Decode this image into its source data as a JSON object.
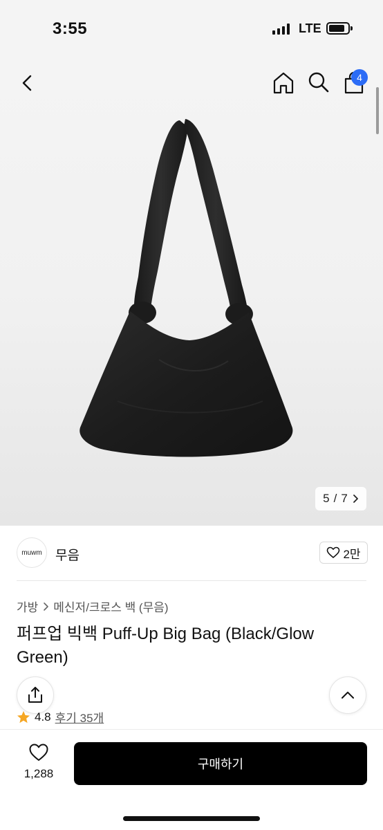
{
  "status_bar": {
    "time": "3:55",
    "network": "LTE"
  },
  "header": {
    "cart_count": "4"
  },
  "gallery": {
    "current": "5",
    "separator": "/",
    "total": "7"
  },
  "brand": {
    "logo_text": "muwm",
    "name": "무음",
    "likes": "2만"
  },
  "product": {
    "breadcrumb": [
      "가방",
      "메신저/크로스 백 (무음)"
    ],
    "title": "퍼프업 빅백 Puff-Up Big Bag (Black/Glow Green)",
    "rating": "4.8",
    "reviews": "후기 35개"
  },
  "bottom_bar": {
    "wish_count": "1,288",
    "buy_label": "구매하기"
  },
  "colors": {
    "badge": "#2c6cf6",
    "star": "#f5a623",
    "buy_button": "#000000"
  }
}
